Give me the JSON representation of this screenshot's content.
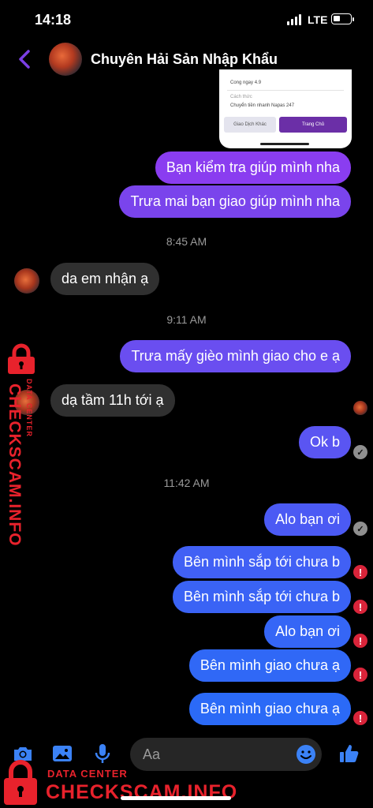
{
  "status_bar": {
    "time": "14:18",
    "network": "LTE",
    "battery_level": 0.4
  },
  "header": {
    "title": "Chuyên Hải Sản Nhập Khẩu",
    "back_icon": "chevron-left-icon",
    "accent": "#7b3fe4"
  },
  "payment_card": {
    "line1": "Cong ngay 4.9",
    "line2": "Cách thức",
    "line3": "Chuyển tiền nhanh Napas 247",
    "btn_secondary": "Giao Dịch Khác",
    "btn_primary": "Trang Chủ"
  },
  "messages": [
    {
      "type": "out",
      "text": "Bạn kiểm tra giúp mình nha",
      "color": "#8a3df0"
    },
    {
      "type": "out",
      "text": "Trưa mai bạn giao giúp mình nha",
      "color": "#7a44ec"
    },
    {
      "type": "time",
      "text": "8:45 AM"
    },
    {
      "type": "in",
      "text": "da em nhận ạ"
    },
    {
      "type": "time",
      "text": "9:11 AM"
    },
    {
      "type": "out",
      "text": "Trưa mấy gièo mình giao cho e ạ",
      "color": "#6a4ef0"
    },
    {
      "type": "in",
      "text": "dạ tầm 11h tới ạ"
    },
    {
      "type": "out",
      "text": "Ok b",
      "status": "sent",
      "color": "#5a55f2"
    },
    {
      "type": "time",
      "text": "11:42 AM"
    },
    {
      "type": "out",
      "text": "Alo bạn ơi",
      "status": "sent",
      "color": "#4b5af4"
    },
    {
      "type": "out",
      "text": "Bên mình sắp tới chưa b",
      "status": "failed",
      "color": "#4160f5"
    },
    {
      "type": "out",
      "text": "Bên mình sắp tới chưa b",
      "status": "failed",
      "color": "#3a63f5"
    },
    {
      "type": "out",
      "text": "Alo bạn ơi",
      "status": "failed",
      "color": "#3566f6"
    },
    {
      "type": "out",
      "text": "Bên mình giao chưa ạ",
      "status": "failed",
      "color": "#3068f6"
    },
    {
      "type": "out",
      "text": "Bên mình giao chưa ạ",
      "status": "failed",
      "color": "#2b6af7"
    }
  ],
  "status_glyphs": {
    "sent": "✓",
    "failed": "!"
  },
  "composer": {
    "placeholder": "Aa",
    "icons": [
      "camera-icon",
      "photo-icon",
      "microphone-icon",
      "emoji-icon",
      "thumbs-up-icon"
    ],
    "icon_color": "#3b82f6"
  },
  "watermark": {
    "label": "DATA CENTER",
    "site": "CHECKSCAM.INFO",
    "color": "#e8222c"
  }
}
